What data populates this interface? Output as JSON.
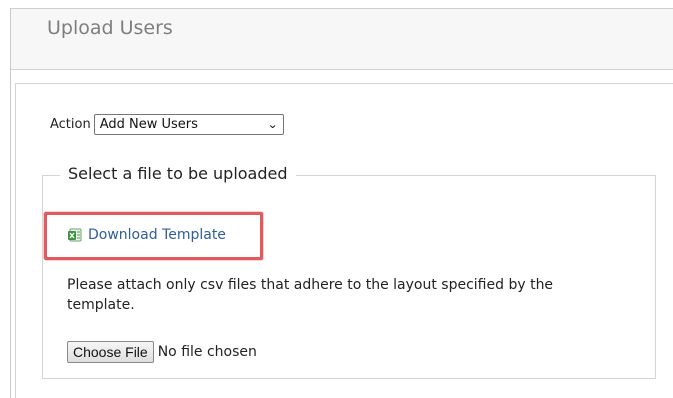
{
  "header": {
    "title": "Upload Users"
  },
  "action": {
    "label": "Action",
    "selected": "Add New Users"
  },
  "file_section": {
    "legend": "Select a file to be uploaded",
    "download_link": "Download Template",
    "instructions": "Please attach only csv files that adhere to the layout specified by the template.",
    "choose_button": "Choose File",
    "file_status": "No file chosen"
  },
  "colors": {
    "link": "#2f5d9b",
    "highlight": "#e05b5b",
    "excel_green": "#3f8f46"
  },
  "icons": {
    "download": "excel-icon",
    "select": "chevron-down-icon"
  }
}
